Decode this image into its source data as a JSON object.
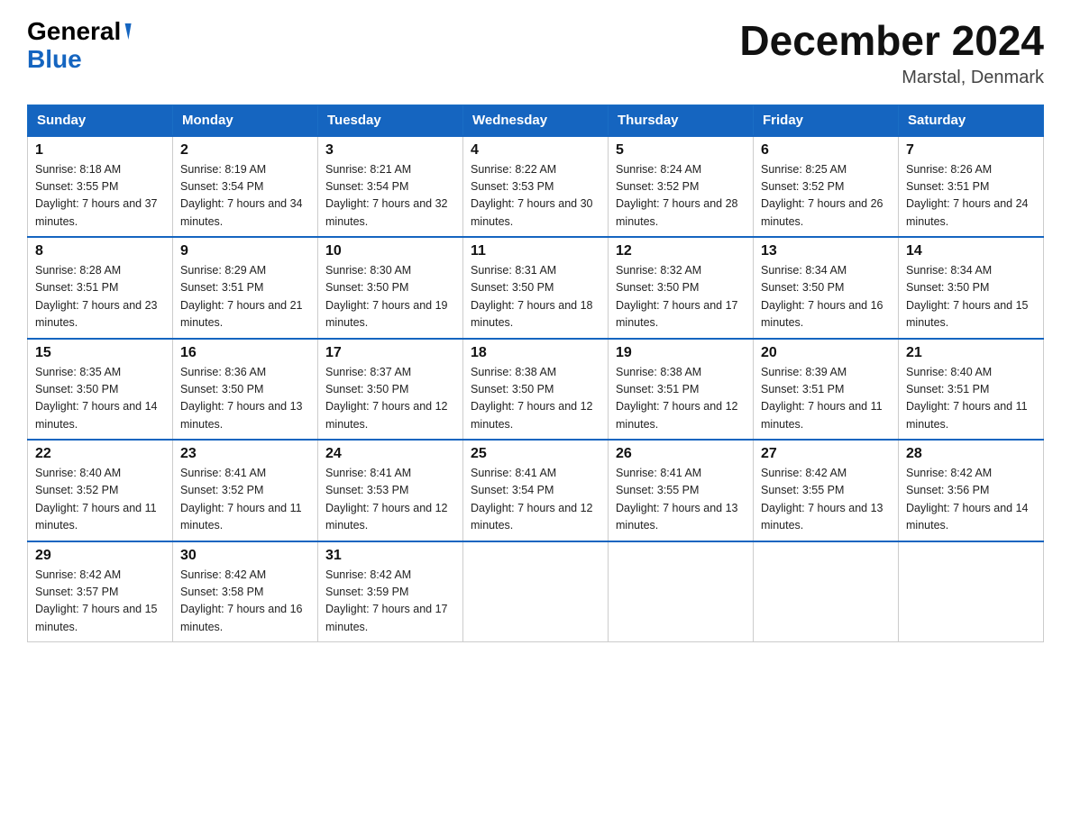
{
  "header": {
    "logo_general": "General",
    "logo_blue": "Blue",
    "month_title": "December 2024",
    "location": "Marstal, Denmark"
  },
  "days_of_week": [
    "Sunday",
    "Monday",
    "Tuesday",
    "Wednesday",
    "Thursday",
    "Friday",
    "Saturday"
  ],
  "weeks": [
    [
      {
        "day": "1",
        "sunrise": "8:18 AM",
        "sunset": "3:55 PM",
        "daylight": "7 hours and 37 minutes."
      },
      {
        "day": "2",
        "sunrise": "8:19 AM",
        "sunset": "3:54 PM",
        "daylight": "7 hours and 34 minutes."
      },
      {
        "day": "3",
        "sunrise": "8:21 AM",
        "sunset": "3:54 PM",
        "daylight": "7 hours and 32 minutes."
      },
      {
        "day": "4",
        "sunrise": "8:22 AM",
        "sunset": "3:53 PM",
        "daylight": "7 hours and 30 minutes."
      },
      {
        "day": "5",
        "sunrise": "8:24 AM",
        "sunset": "3:52 PM",
        "daylight": "7 hours and 28 minutes."
      },
      {
        "day": "6",
        "sunrise": "8:25 AM",
        "sunset": "3:52 PM",
        "daylight": "7 hours and 26 minutes."
      },
      {
        "day": "7",
        "sunrise": "8:26 AM",
        "sunset": "3:51 PM",
        "daylight": "7 hours and 24 minutes."
      }
    ],
    [
      {
        "day": "8",
        "sunrise": "8:28 AM",
        "sunset": "3:51 PM",
        "daylight": "7 hours and 23 minutes."
      },
      {
        "day": "9",
        "sunrise": "8:29 AM",
        "sunset": "3:51 PM",
        "daylight": "7 hours and 21 minutes."
      },
      {
        "day": "10",
        "sunrise": "8:30 AM",
        "sunset": "3:50 PM",
        "daylight": "7 hours and 19 minutes."
      },
      {
        "day": "11",
        "sunrise": "8:31 AM",
        "sunset": "3:50 PM",
        "daylight": "7 hours and 18 minutes."
      },
      {
        "day": "12",
        "sunrise": "8:32 AM",
        "sunset": "3:50 PM",
        "daylight": "7 hours and 17 minutes."
      },
      {
        "day": "13",
        "sunrise": "8:34 AM",
        "sunset": "3:50 PM",
        "daylight": "7 hours and 16 minutes."
      },
      {
        "day": "14",
        "sunrise": "8:34 AM",
        "sunset": "3:50 PM",
        "daylight": "7 hours and 15 minutes."
      }
    ],
    [
      {
        "day": "15",
        "sunrise": "8:35 AM",
        "sunset": "3:50 PM",
        "daylight": "7 hours and 14 minutes."
      },
      {
        "day": "16",
        "sunrise": "8:36 AM",
        "sunset": "3:50 PM",
        "daylight": "7 hours and 13 minutes."
      },
      {
        "day": "17",
        "sunrise": "8:37 AM",
        "sunset": "3:50 PM",
        "daylight": "7 hours and 12 minutes."
      },
      {
        "day": "18",
        "sunrise": "8:38 AM",
        "sunset": "3:50 PM",
        "daylight": "7 hours and 12 minutes."
      },
      {
        "day": "19",
        "sunrise": "8:38 AM",
        "sunset": "3:51 PM",
        "daylight": "7 hours and 12 minutes."
      },
      {
        "day": "20",
        "sunrise": "8:39 AM",
        "sunset": "3:51 PM",
        "daylight": "7 hours and 11 minutes."
      },
      {
        "day": "21",
        "sunrise": "8:40 AM",
        "sunset": "3:51 PM",
        "daylight": "7 hours and 11 minutes."
      }
    ],
    [
      {
        "day": "22",
        "sunrise": "8:40 AM",
        "sunset": "3:52 PM",
        "daylight": "7 hours and 11 minutes."
      },
      {
        "day": "23",
        "sunrise": "8:41 AM",
        "sunset": "3:52 PM",
        "daylight": "7 hours and 11 minutes."
      },
      {
        "day": "24",
        "sunrise": "8:41 AM",
        "sunset": "3:53 PM",
        "daylight": "7 hours and 12 minutes."
      },
      {
        "day": "25",
        "sunrise": "8:41 AM",
        "sunset": "3:54 PM",
        "daylight": "7 hours and 12 minutes."
      },
      {
        "day": "26",
        "sunrise": "8:41 AM",
        "sunset": "3:55 PM",
        "daylight": "7 hours and 13 minutes."
      },
      {
        "day": "27",
        "sunrise": "8:42 AM",
        "sunset": "3:55 PM",
        "daylight": "7 hours and 13 minutes."
      },
      {
        "day": "28",
        "sunrise": "8:42 AM",
        "sunset": "3:56 PM",
        "daylight": "7 hours and 14 minutes."
      }
    ],
    [
      {
        "day": "29",
        "sunrise": "8:42 AM",
        "sunset": "3:57 PM",
        "daylight": "7 hours and 15 minutes."
      },
      {
        "day": "30",
        "sunrise": "8:42 AM",
        "sunset": "3:58 PM",
        "daylight": "7 hours and 16 minutes."
      },
      {
        "day": "31",
        "sunrise": "8:42 AM",
        "sunset": "3:59 PM",
        "daylight": "7 hours and 17 minutes."
      },
      null,
      null,
      null,
      null
    ]
  ]
}
